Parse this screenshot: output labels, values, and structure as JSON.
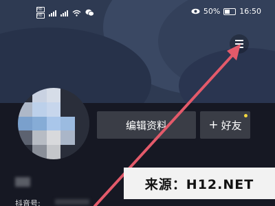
{
  "status_bar": {
    "sim_labels": [
      "HD",
      "HD"
    ],
    "battery": "50%",
    "time": "16:50",
    "icons": [
      "sim-hd-icon",
      "signal-icon",
      "wifi-icon",
      "wechat-icon",
      "eye-icon",
      "battery-icon"
    ]
  },
  "header": {
    "menu_icon": "hamburger-menu-icon"
  },
  "profile": {
    "edit_profile_label": "编辑资料",
    "add_friend_label": "好友",
    "add_friend_icon": "plus-icon",
    "douyin_id_label": "抖音号:"
  },
  "overlay": {
    "watermark_text": "来源：H12.NET",
    "arrow_color": "#e35a6a"
  },
  "colors": {
    "background_dark": "#161823",
    "banner": "#2e3a52",
    "button": "#3a3d46",
    "badge": "#f4d83e"
  }
}
